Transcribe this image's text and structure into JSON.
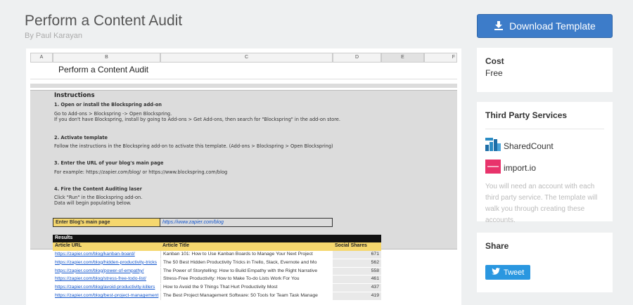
{
  "header": {
    "title": "Perform a Content Audit",
    "byline": "By Paul Karayan"
  },
  "sheet": {
    "columns": [
      "A",
      "B",
      "C",
      "D",
      "E",
      "F"
    ],
    "title": "Perform a Content Audit",
    "instructions": {
      "heading": "Instructions",
      "s1_head": "1. Open or install the Blockspring add-on",
      "s1_l1": "Go to Add-ons > Blockspring -> Open Blockspring.",
      "s1_l2": "If you don't have Blockspring, install by going to Add-ons > Get Add-ons, then search for \"Blockspring\" in the add-on store.",
      "s2_head": "2. Activate template",
      "s2_l1": "Follow the instructions in the Blockspring add-on to activate this template. (Add-ons > Blockspring > Open Blockspring)",
      "s3_head": "3. Enter the URL of your blog's main page",
      "s3_l1": "For example: https://zapier.com/blog/  or https://www.blockspring.com/blog",
      "s4_head": "4. Fire the Content Auditing laser",
      "s4_l1": "Click \"Run\" in the Blockspring add-on.",
      "s4_l2": "Data will begin populating below."
    },
    "entry": {
      "label": "Enter Blog's main page",
      "value": "https://www.zapier.com/blog"
    },
    "results": {
      "label": "Results",
      "headers": [
        "Article URL",
        "Article Title",
        "Social Shares"
      ],
      "rows": [
        {
          "url": "https://zapier.com/blog/kanban-board/",
          "title": "Kanban 101: How to Use Kanban Boards to Manage Your Next Project",
          "shares": "671"
        },
        {
          "url": "https://zapier.com/blog/hidden-productivity-tricks",
          "title": "The 50 Best Hidden Productivity Tricks in Trello, Slack, Evernote and Mo",
          "shares": "562"
        },
        {
          "url": "https://zapier.com/blog/power-of-empathy/",
          "title": "The Power of Storytelling: How to Build Empathy with the Right Narrative",
          "shares": "558"
        },
        {
          "url": "https://zapier.com/blog/stress-free-todo-list/",
          "title": "Stress-Free Productivity: How to Make To-do Lists Work For You",
          "shares": "461"
        },
        {
          "url": "https://zapier.com/blog/avoid-productivity-killers",
          "title": "How to Avoid the 9 Things That Hurt Productivity Most",
          "shares": "437"
        },
        {
          "url": "https://zapier.com/blog/best-project-management",
          "title": "The Best Project Management Software: 50 Tools for Team Task Manage",
          "shares": "419"
        }
      ]
    }
  },
  "sidebar": {
    "download_label": "Download Template",
    "cost": {
      "title": "Cost",
      "value": "Free"
    },
    "services": {
      "title": "Third Party Services",
      "items": [
        "SharedCount",
        "import.io"
      ],
      "note": "You will need an account with each third party service. The template will walk you through creating these accounts."
    },
    "share": {
      "title": "Share",
      "tweet_label": "Tweet"
    }
  },
  "colors": {
    "accent": "#3d7cc9",
    "highlight": "#f5d76e",
    "twitter": "#2a97e0",
    "link": "#1155cc"
  }
}
